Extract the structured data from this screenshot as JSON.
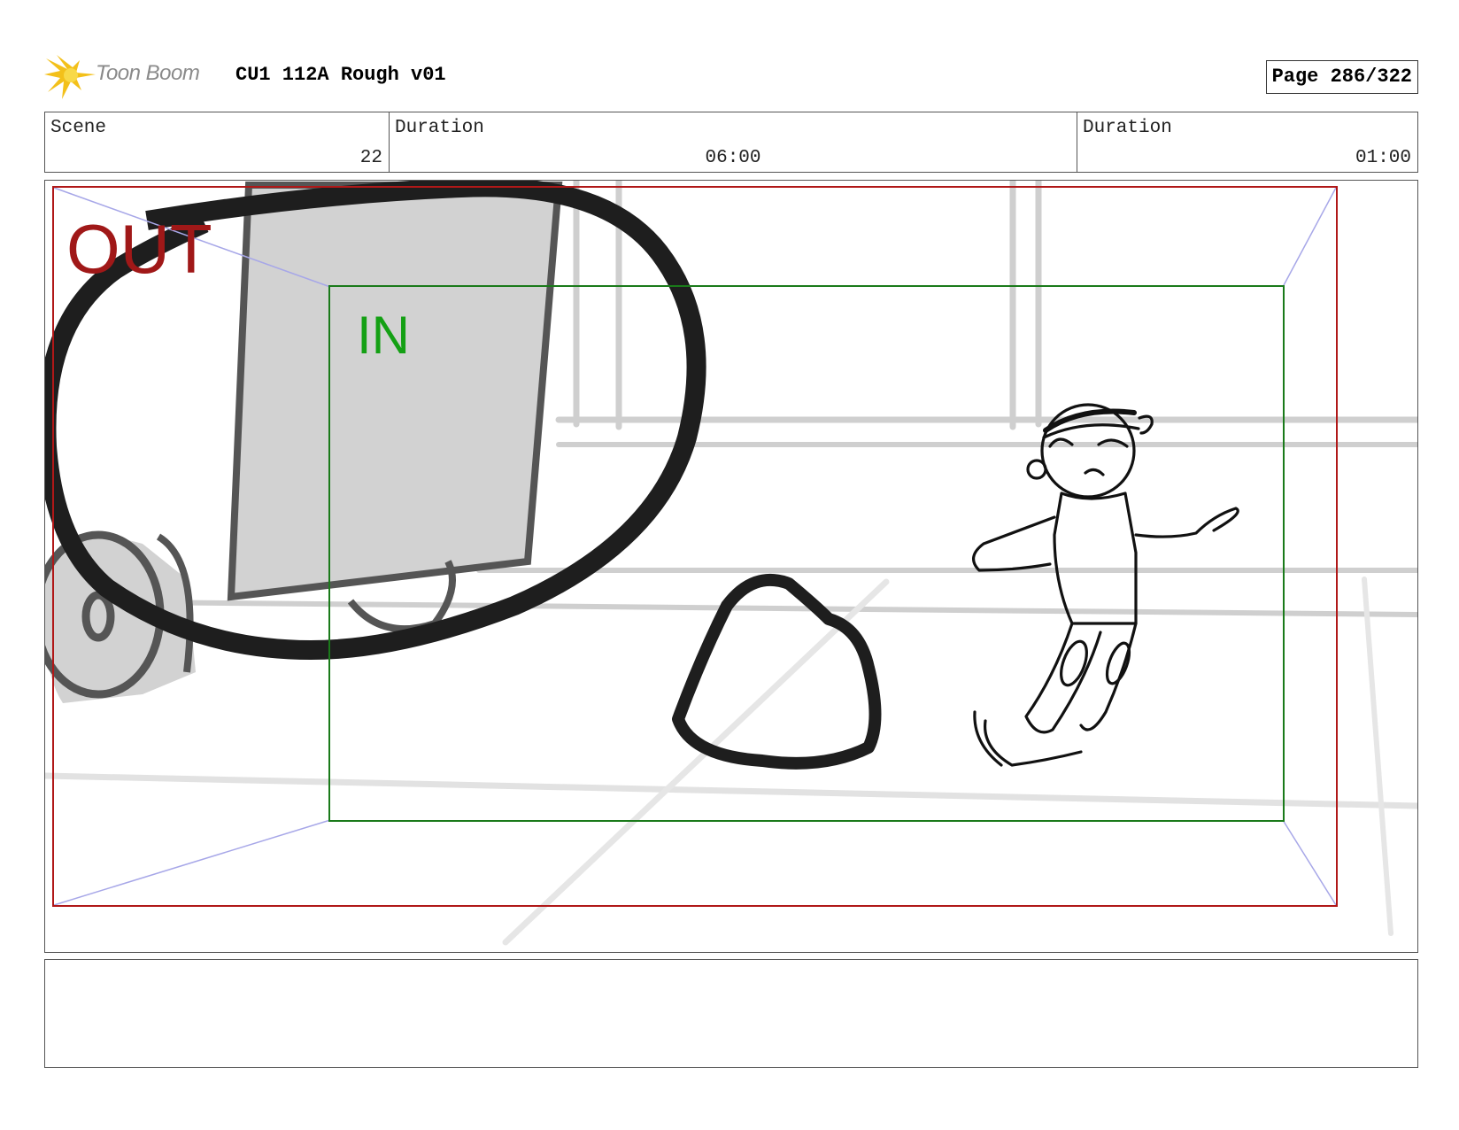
{
  "header": {
    "brand": "Toon Boom",
    "title": "CU1 112A Rough v01",
    "page": "Page 286/322"
  },
  "info": {
    "scene_label": "Scene",
    "scene_value": "22",
    "duration1_label": "Duration",
    "duration1_value": "06:00",
    "duration2_label": "Duration",
    "duration2_value": "01:00"
  },
  "panel": {
    "out_label": "OUT",
    "in_label": "IN"
  },
  "colors": {
    "out_frame": "#b01818",
    "in_frame": "#1a7a1a",
    "logo_yellow": "#f3c01a"
  },
  "icons": [
    "toon-boom-logo-icon"
  ]
}
